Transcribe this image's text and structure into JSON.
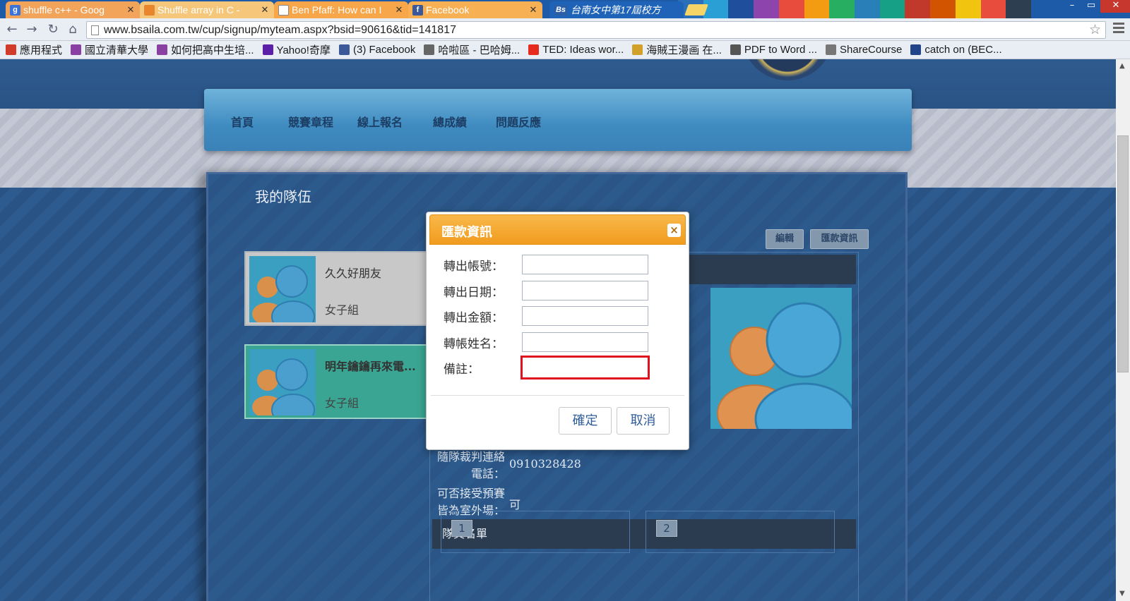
{
  "browser": {
    "tabs": [
      {
        "label": "shuffle c++ - Goog",
        "icon_color": "#3b73d8",
        "icon_glyph": "g",
        "bg": "#f2a55a"
      },
      {
        "label": "Shuffle array in C -",
        "icon_color": "#e8862e",
        "icon_glyph": "",
        "bg": "#f6c77a"
      },
      {
        "label": "Ben Pfaff: How can I",
        "icon_color": "#ffffff",
        "icon_glyph": "",
        "bg": "#f7a64a"
      },
      {
        "label": "Facebook",
        "icon_color": "#3b5998",
        "icon_glyph": "f",
        "bg": "#f7b054"
      },
      {
        "label": "台南女中第17屆校方",
        "icon_color": "#2a5fa8",
        "icon_glyph": "Bs",
        "bg": "#1e63b8"
      }
    ],
    "url": "www.bsaila.com.tw/cup/signup/myteam.aspx?bsid=90616&tid=141817",
    "bookmarks": [
      {
        "label": "應用程式",
        "icon_color": "#d23a2a"
      },
      {
        "label": "國立清華大學",
        "icon_color": "#8a3fa2"
      },
      {
        "label": "如何把高中生培...",
        "icon_color": "#8a3fa2"
      },
      {
        "label": "Yahoo!奇摩",
        "icon_color": "#5b1fa8"
      },
      {
        "label": "(3) Facebook",
        "icon_color": "#3b5998"
      },
      {
        "label": "哈啦區 - 巴哈姆...",
        "icon_color": "#666666"
      },
      {
        "label": "TED: Ideas wor...",
        "icon_color": "#e62b1e"
      },
      {
        "label": "海賊王漫画 在...",
        "icon_color": "#d2a12a"
      },
      {
        "label": "PDF to Word ...",
        "icon_color": "#555555"
      },
      {
        "label": "ShareCourse",
        "icon_color": "#777777"
      },
      {
        "label": "catch on (BEC...",
        "icon_color": "#224488"
      }
    ],
    "stripe_colors": [
      "#2b6fb8",
      "#2a9fd6",
      "#1f4e9c",
      "#8e44ad",
      "#e74c3c",
      "#f39c12",
      "#27ae60",
      "#2980b9",
      "#16a085",
      "#c0392b",
      "#d35400",
      "#f1c40f",
      "#e74c3c",
      "#2c3e50"
    ]
  },
  "site": {
    "nav": [
      "首頁",
      "競賽章程",
      "線上報名",
      "總成績",
      "問題反應"
    ],
    "panel_title": "我的隊伍",
    "buttons": {
      "edit": "編輯",
      "remit_info": "匯款資訊"
    },
    "teams": [
      {
        "name": "久久好朋友",
        "group": "女子組",
        "bg": "#c8c8c8"
      },
      {
        "name": "明年鑰鑰再來電...",
        "group": "女子組",
        "bg": "#3aa592"
      }
    ],
    "details": [
      {
        "label": "隨隊裁判連絡電話：",
        "value": "0910328428"
      },
      {
        "label": "可否接受預賽皆為室外場：",
        "value": "可"
      }
    ],
    "roster_title": "隊員名單",
    "member_numbers": [
      "1",
      "2"
    ]
  },
  "modal": {
    "title": "匯款資訊",
    "close_glyph": "×",
    "fields": [
      {
        "label": "轉出帳號：",
        "value": ""
      },
      {
        "label": "轉出日期：",
        "value": ""
      },
      {
        "label": "轉出金額：",
        "value": ""
      },
      {
        "label": "轉帳姓名：",
        "value": ""
      },
      {
        "label": "備註：",
        "value": ""
      }
    ],
    "confirm": "確定",
    "cancel": "取消",
    "header_color": "#f5a832",
    "focus_color": "#e0111f"
  }
}
